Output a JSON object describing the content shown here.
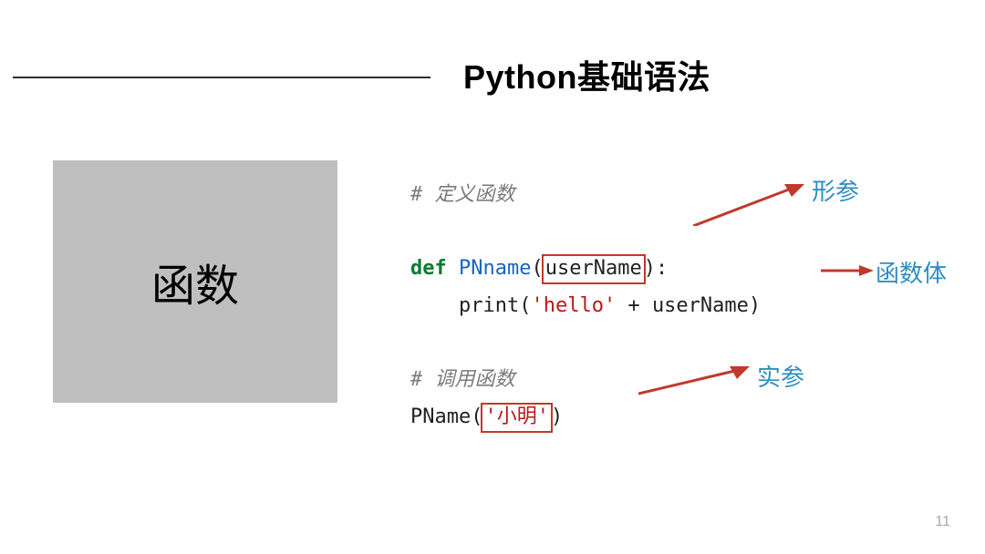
{
  "header": {
    "title": "Python基础语法"
  },
  "sidebar": {
    "label": "函数"
  },
  "code": {
    "comment_define": "# 定义函数",
    "def_kw": "def",
    "fn_name": "PNname",
    "param": "userName",
    "body_print": "print",
    "body_str": "'hello'",
    "body_plus": " + ",
    "body_var": "userName",
    "comment_call": "# 调用函数",
    "call_name": "PName",
    "call_arg": "'小明'"
  },
  "annotations": {
    "formal_param": "形参",
    "body": "函数体",
    "actual_param": "实参"
  },
  "page_number": "11"
}
